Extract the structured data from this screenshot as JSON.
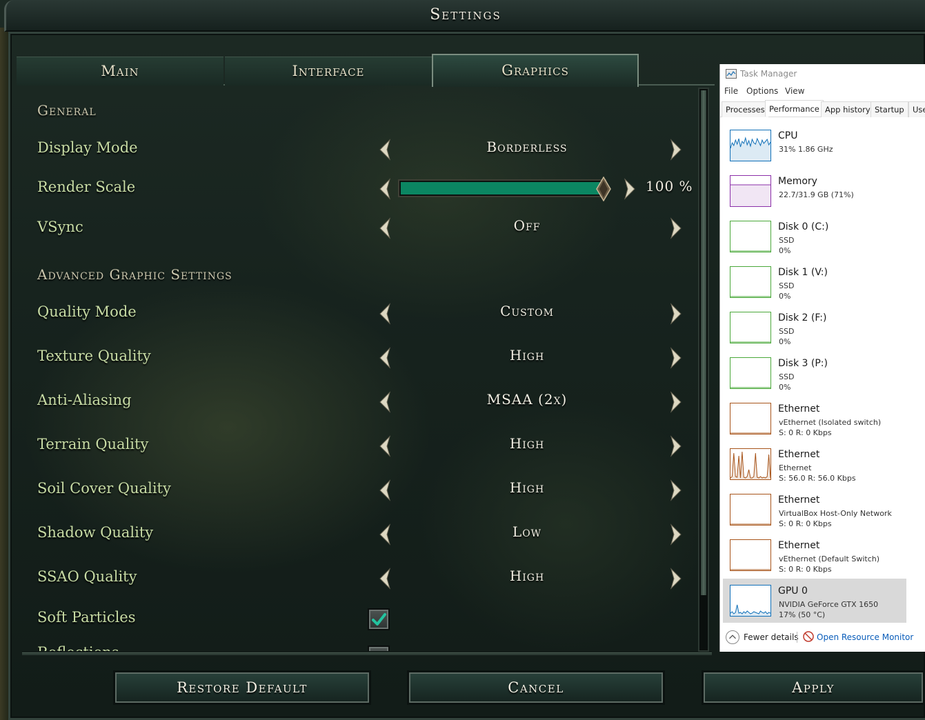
{
  "window": {
    "title": "Settings"
  },
  "tabs": [
    {
      "label": "Main",
      "active": false
    },
    {
      "label": "Interface",
      "active": false
    },
    {
      "label": "Graphics",
      "active": true
    }
  ],
  "sections": {
    "general": "General",
    "advanced": "Advanced Graphic Settings"
  },
  "settings": {
    "display_mode": {
      "label": "Display Mode",
      "value": "Borderless"
    },
    "render_scale": {
      "label": "Render Scale",
      "percent_label": "100 %",
      "level": 1.0
    },
    "vsync": {
      "label": "VSync",
      "value": "Off"
    },
    "quality_mode": {
      "label": "Quality Mode",
      "value": "Custom"
    },
    "texture_quality": {
      "label": "Texture Quality",
      "value": "High"
    },
    "anti_aliasing": {
      "label": "Anti-Aliasing",
      "value": "MSAA (2x)"
    },
    "terrain_quality": {
      "label": "Terrain Quality",
      "value": "High"
    },
    "soil_cover_quality": {
      "label": "Soil Cover Quality",
      "value": "High"
    },
    "shadow_quality": {
      "label": "Shadow Quality",
      "value": "Low"
    },
    "ssao_quality": {
      "label": "SSAO Quality",
      "value": "High"
    },
    "soft_particles": {
      "label": "Soft Particles",
      "checked": true
    },
    "reflections": {
      "label": "Reflections"
    }
  },
  "buttons": {
    "restore_default": "Restore Default",
    "cancel": "Cancel",
    "apply": "Apply"
  },
  "colors": {
    "accent": "#0b8662",
    "label_text": "#c8dca5",
    "header_text": "#cbc7ad"
  },
  "task_manager": {
    "title": "Task Manager",
    "menu": [
      "File",
      "Options",
      "View"
    ],
    "tabs": [
      "Processes",
      "Performance",
      "App history",
      "Startup",
      "User"
    ],
    "active_tab": "Performance",
    "items": [
      {
        "name": "CPU",
        "line1": "31%  1.86 GHz",
        "line2": "",
        "color": "#1170b8",
        "selected": false
      },
      {
        "name": "Memory",
        "line1": "22.7/31.9 GB (71%)",
        "line2": "",
        "color": "#8b2fa8",
        "selected": false
      },
      {
        "name": "Disk 0 (C:)",
        "line1": "SSD",
        "line2": "0%",
        "color": "#4aa83a",
        "selected": false
      },
      {
        "name": "Disk 1 (V:)",
        "line1": "SSD",
        "line2": "0%",
        "color": "#4aa83a",
        "selected": false
      },
      {
        "name": "Disk 2 (F:)",
        "line1": "SSD",
        "line2": "0%",
        "color": "#4aa83a",
        "selected": false
      },
      {
        "name": "Disk 3 (P:)",
        "line1": "SSD",
        "line2": "0%",
        "color": "#4aa83a",
        "selected": false
      },
      {
        "name": "Ethernet",
        "line1": "vEthernet (Isolated switch)",
        "line2": "S: 0  R: 0 Kbps",
        "color": "#a7541a",
        "selected": false
      },
      {
        "name": "Ethernet",
        "line1": "Ethernet",
        "line2": "S: 56.0  R: 56.0 Kbps",
        "color": "#a7541a",
        "selected": false
      },
      {
        "name": "Ethernet",
        "line1": "VirtualBox Host-Only Network",
        "line2": "S: 0  R: 0 Kbps",
        "color": "#a7541a",
        "selected": false
      },
      {
        "name": "Ethernet",
        "line1": "vEthernet (Default Switch)",
        "line2": "S: 0  R: 0 Kbps",
        "color": "#a7541a",
        "selected": false
      },
      {
        "name": "GPU 0",
        "line1": "NVIDIA GeForce GTX 1650",
        "line2": "17%  (50 °C)",
        "color": "#1170b8",
        "selected": true
      }
    ],
    "footer": {
      "fewer_details": "Fewer details",
      "open_resource_monitor": "Open Resource Monitor"
    }
  }
}
